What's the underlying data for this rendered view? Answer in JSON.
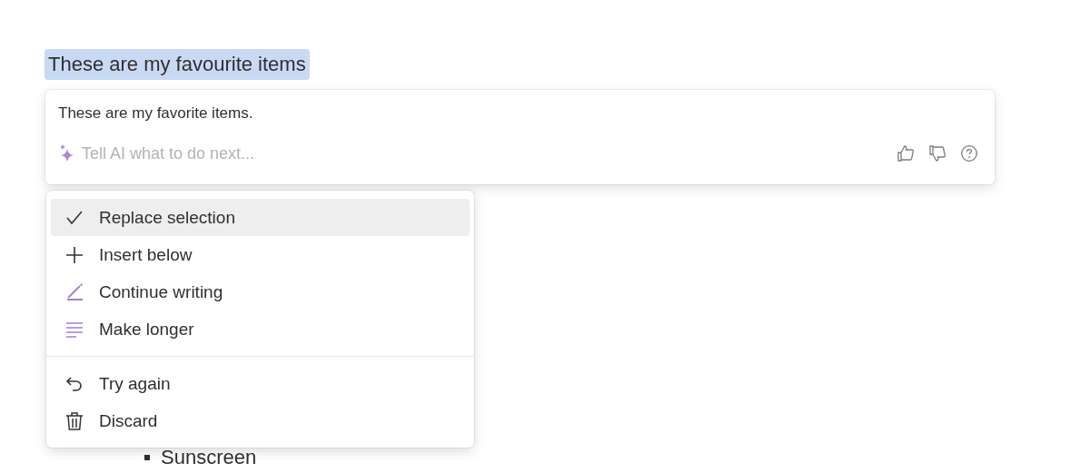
{
  "document": {
    "selected_text": "These are my favourite items",
    "list": [
      {
        "text": "Sunscreen"
      }
    ]
  },
  "ai_panel": {
    "result": "These are my favorite items.",
    "prompt_placeholder": "Tell AI what to do next..."
  },
  "menu": {
    "sections": [
      [
        {
          "label": "Replace selection",
          "selected": true
        },
        {
          "label": "Insert below",
          "selected": false
        },
        {
          "label": "Continue writing",
          "selected": false
        },
        {
          "label": "Make longer",
          "selected": false
        }
      ],
      [
        {
          "label": "Try again",
          "selected": false
        },
        {
          "label": "Discard",
          "selected": false
        }
      ]
    ]
  }
}
